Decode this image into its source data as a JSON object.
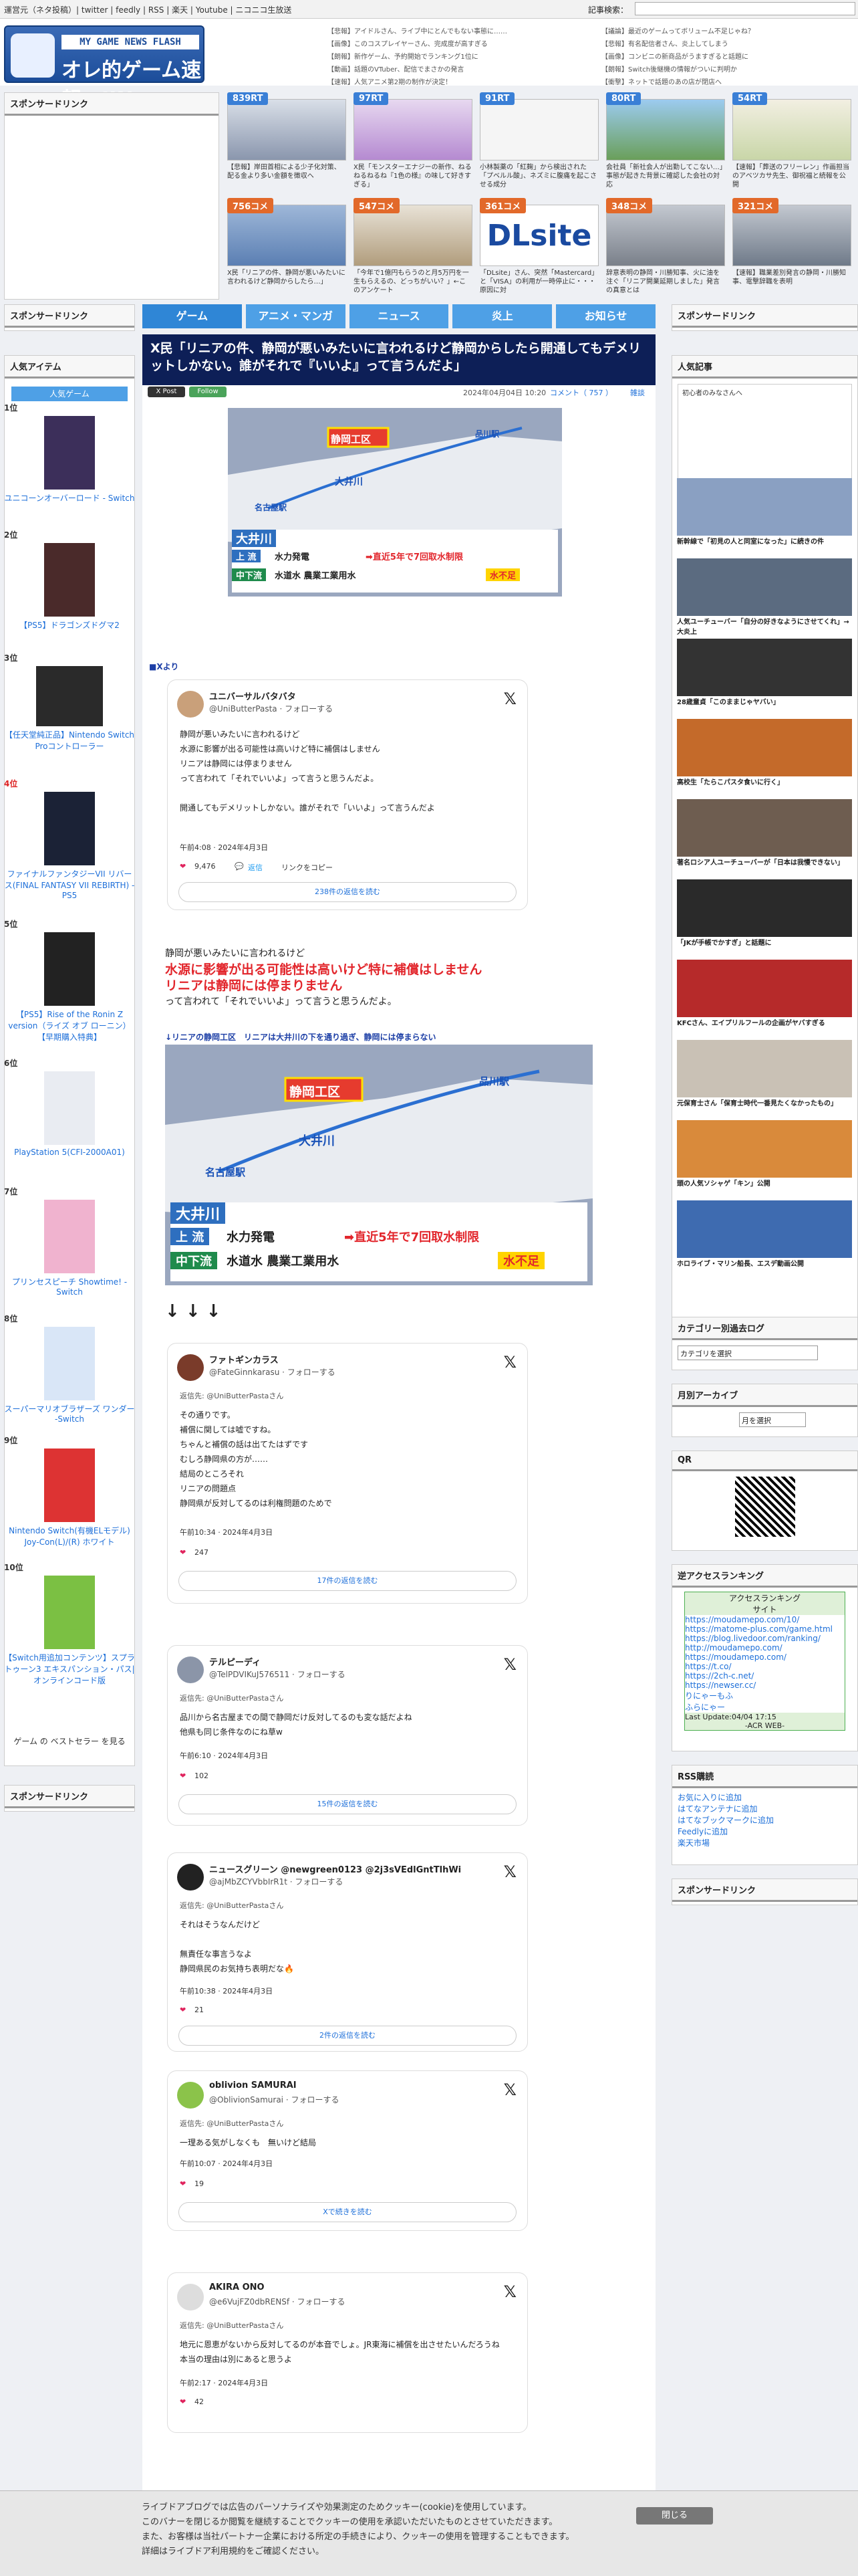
{
  "topbar": {
    "links": "運営元（ネタ投稿）| twitter | feedly | RSS | 楽天 | Youtube | ニコニコ生放送",
    "search_label": "記事検索："
  },
  "logo": {
    "sub": "MY GAME NEWS FLASH",
    "main": "オレ的ゲーム速報@JIN"
  },
  "header_links_left": [
    "【悲報】アイドルさん、ライブ中にとんでもない事態に……",
    "【画像】このコスプレイヤーさん、完成度が高すぎる",
    "【朗報】新作ゲーム、予約開始でランキング1位に",
    "【動画】話題のVTuber、配信でまさかの発言",
    "【速報】人気アニメ第2期の制作が決定！"
  ],
  "header_links_right": [
    "【議論】最近のゲームってボリューム不足じゃね？",
    "【悲報】有名配信者さん、炎上してしまう",
    "【画像】コンビニの新商品がうますぎると話題に",
    "【朗報】Switch後継機の情報がついに判明か",
    "【衝撃】ネットで話題のあの店が閉店へ"
  ],
  "sponsor": "スポンサードリンク",
  "hot_items": [
    {
      "badge": "839RT",
      "color": "#3a7fd6",
      "caption": "【悲報】岸田首相による少子化対策、配る金より多い金額を徴収へ"
    },
    {
      "badge": "97RT",
      "color": "#3a7fd6",
      "caption": "X民「モンスターエナジーの新作、ねるねるねるね『1色の様』の味して好きすぎる」"
    },
    {
      "badge": "91RT",
      "color": "#3a7fd6",
      "caption": "小林製薬の「紅麹」から検出された「プベルル酸」、ネズミに腹痛を起こさせる成分"
    },
    {
      "badge": "80RT",
      "color": "#3a7fd6",
      "caption": "会社員「新社会人が出勤してこない…」事態が起きた背景に確認した会社の対応"
    },
    {
      "badge": "54RT",
      "color": "#3a7fd6",
      "caption": "【速報】「葬送のフリーレン」作画担当のアベツカサ先生、御祝福と続報を公開"
    },
    {
      "badge": "756コメ",
      "color": "#e2692a",
      "caption": "X民「リニアの件、静岡が悪いみたいに言われるけど静岡からしたら…」"
    },
    {
      "badge": "547コメ",
      "color": "#e2692a",
      "caption": "「今年で1億円もらうのと月5万円を一生もらえるの、どっちがいい？」←このアンケート"
    },
    {
      "badge": "361コメ",
      "color": "#e2692a",
      "caption": "「DLsite」さん、突然「Mastercard」と「VISA」の利用が一時停止に・・・原因に対"
    },
    {
      "badge": "348コメ",
      "color": "#e2692a",
      "caption": "辞意表明の静岡・川勝知事、火に油を注ぐ「リニア開業延期しました」発言の真意とは"
    },
    {
      "badge": "321コメ",
      "color": "#e2692a",
      "caption": "【速報】職業差別発言の静岡・川勝知事、電撃辞職を表明"
    }
  ],
  "nav": [
    "ゲーム",
    "アニメ・マンガ",
    "ニュース",
    "炎上",
    "お知らせ"
  ],
  "article": {
    "title": "X民「リニアの件、静岡が悪いみたいに言われるけど静岡からしたら開通してもデメリットしかない。誰がそれで『いいよ』って言うんだよ」",
    "date": "2024年04月04日 10:20",
    "comments": "コメント（ 757 ）",
    "category": "雑談",
    "x_post": "X Post",
    "follow": "Follow",
    "source": "■Xより"
  },
  "map": {
    "shizuoka": "静岡工区",
    "shinagawa": "品川駅",
    "nagoya": "名古屋駅",
    "oi": "大井川",
    "oi_box": "大井川",
    "up": "上 流",
    "up_text": "水力発電",
    "mid": "中下流",
    "mid_text": "水道水 農業工業用水",
    "arrow": "➡直近5年で7回取水制限",
    "shortage": "水不足"
  },
  "tweets": [
    {
      "name": "ユニバーサルバタバタ",
      "handle": "@UniButterPasta · フォローする",
      "body": [
        "静岡が悪いみたいに言われるけど",
        "水源に影響が出る可能性は高いけど特に補償はしません",
        "リニアは静岡には停まりません",
        "って言われて「それでいいよ」って言うと思うんだよ。",
        "",
        "開通してもデメリットしかない。誰がそれで「いいよ」って言うんだよ"
      ],
      "time": "午前4:08 · 2024年4月3日",
      "likes": "9,476",
      "reply": "返信",
      "share": "リンクをコピー",
      "more": "238件の返信を読む"
    },
    {
      "name": "ファトギンカラス",
      "handle": "@FateGinnkarasu · フォローする",
      "reply_to": "返信先: @UniButterPastaさん",
      "body": [
        "その通りです。",
        "補償に関しては嘘ですね。",
        "ちゃんと補償の話は出てたはずです",
        "むしろ静岡県の方が……",
        "結局のところそれ",
        "リニアの問題点",
        "静岡県が反対してるのは利権問題のためで"
      ],
      "time": "午前10:34 · 2024年4月3日",
      "likes": "247",
      "more": "17件の返信を読む"
    },
    {
      "name": "テルピーディ",
      "handle": "@TelPDVIKuJ576511 · フォローする",
      "reply_to": "返信先: @UniButterPastaさん",
      "body": [
        "品川から名古屋までの間で静岡だけ反対してるのも変な話だよね",
        "他県も同じ条件なのにね草w"
      ],
      "time": "午前6:10 · 2024年4月3日",
      "likes": "102",
      "more": "15件の返信を読む"
    },
    {
      "name": "ニュースグリーン @newgreen0123 @2j3sVEdlGntTlhWi",
      "handle": "@ajMbZCYVbbIrR1t · フォローする",
      "reply_to": "返信先: @UniButterPastaさん",
      "body": [
        "それはそうなんだけど",
        "",
        "無責任な事言うなよ",
        "静岡県民のお気持ち表明だな🔥"
      ],
      "time": "午前10:38 · 2024年4月3日",
      "likes": "21",
      "more": "2件の返信を読む"
    },
    {
      "name": "oblivion SAMURAI",
      "handle": "@OblivionSamurai · フォローする",
      "reply_to": "返信先: @UniButterPastaさん",
      "body": [
        "一理ある気がしなくも　無いけど結局"
      ],
      "time": "午前10:07 · 2024年4月3日",
      "likes": "19",
      "more": "Xで続きを読む"
    },
    {
      "name": "AKIRA ONO",
      "handle": "@e6VujFZ0dbRENSf · フォローする",
      "reply_to": "返信先: @UniButterPastaさん",
      "body": [
        "地元に恩恵がないから反対してるのが本音でしょ。JR東海に補償を出させたいんだろうね",
        "本当の理由は別にあると思うよ"
      ],
      "time": "午前2:17 · 2024年4月3日",
      "likes": "42"
    }
  ],
  "article_text": {
    "line1": "静岡が悪いみたいに言われるけど",
    "line2": "水源に影響が出る可能性は高いけど特に補償はしません",
    "line3": "リニアは静岡には停まりません",
    "line4": "って言われて「それでいいよ」って言うと思うんだよ。",
    "caption": "↓リニアの静岡工区　リニアは大井川の下を通り過ぎ、静岡には停まらない",
    "arrows": "↓ ↓ ↓"
  },
  "left": {
    "popular": "人気アイテム",
    "tab": "人気ゲーム",
    "ranks": [
      {
        "no": "1位",
        "name": "ユニコーンオーバーロード - Switch"
      },
      {
        "no": "2位",
        "name": "【PS5】ドラゴンズドグマ2"
      },
      {
        "no": "3位",
        "name": "【任天堂純正品】Nintendo Switch Proコントローラー"
      },
      {
        "no": "4位",
        "name": "ファイナルファンタジーVII リバース(FINAL FANTASY VII REBIRTH) -PS5"
      },
      {
        "no": "5位",
        "name": "【PS5】Rise of the Ronin Z version（ライズ オブ ローニン）【早期購入特典】"
      },
      {
        "no": "6位",
        "name": "PlayStation 5(CFI-2000A01)"
      },
      {
        "no": "7位",
        "name": "プリンセスピーチ Showtime! -Switch"
      },
      {
        "no": "8位",
        "name": "スーパーマリオブラザーズ ワンダー -Switch"
      },
      {
        "no": "9位",
        "name": "Nintendo Switch(有機ELモデル) Joy-Con(L)/(R) ホワイト"
      },
      {
        "no": "10位",
        "name": "【Switch用追加コンテンツ】スプラトゥーン3 エキスパンション・パス|オンラインコード版"
      }
    ],
    "more": "ゲーム の ベストセラー を見る"
  },
  "right": {
    "recent": "人気記事",
    "notice": "初心者のみなさんへ",
    "items": [
      "新幹線で「初見の人と同室になった」に続きの件",
      "人気ユーチューバー「自分の好きなようにさせてくれ」→ 大炎上",
      "28歳童貞「このままじゃヤバい」",
      "高校生「たらこパスタ食いに行く」",
      "著名ロシア人ユーチューバーが「日本は我慢できない」",
      "「JKが手帳でかすぎ」と話題に",
      "KFCさん、エイプリルフールの企画がヤバすぎる",
      "元保育士さん「保育士時代一番見たくなかったもの」",
      "頭の人気ソシャゲ「キン」公開",
      "ホロライブ・マリン船長、エスデ動画公開"
    ],
    "catlog": "カテゴリー別過去ログ",
    "cat_select": "カテゴリを選択",
    "archive": "月別アーカイブ",
    "month_select": "月を選択",
    "qr": "QR",
    "access": "逆アクセスランキング",
    "access_title": "アクセスランキング",
    "access_site": "サイト",
    "access_rows": [
      "https://moudamepo.com/10/",
      "https://matome-plus.com/game.html",
      "https://blog.livedoor.com/ranking/",
      "http://moudamepo.com/",
      "https://moudamepo.com/",
      "https://t.co/",
      "https://2ch-c.net/",
      "https://newser.cc/",
      "りにゃーもふ",
      "ふらにゃー"
    ],
    "access_update": "Last Update:04/04 17:15",
    "access_footer": "-ACR WEB-",
    "rss": "RSS購読",
    "rss_links": [
      "お気に入りに追加",
      "はてなアンテナに追加",
      "はてなブックマークに追加",
      "Feedlyに追加",
      "楽天市場"
    ]
  },
  "cookie": {
    "lines": [
      "ライブドアブログでは広告のパーソナライズや効果測定のためクッキー(cookie)を使用しています。",
      "このバナーを閉じるか閲覧を継続することでクッキーの使用を承認いただいたものとさせていただきます。",
      "また、お客様は当社パートナー企業における所定の手続きにより、クッキーの使用を管理することもできます。",
      "詳細はライブドア利用規約をご確認ください。"
    ],
    "close": "閉じる"
  }
}
